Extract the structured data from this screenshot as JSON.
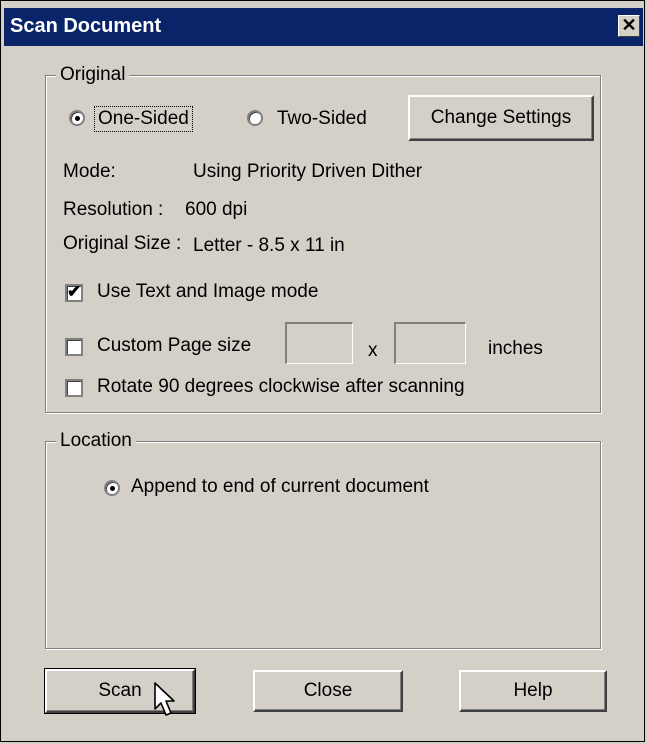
{
  "window": {
    "title": "Scan Document",
    "close_glyph": "✕"
  },
  "original": {
    "legend": "Original",
    "one_sided": "One-Sided",
    "two_sided": "Two-Sided",
    "change_settings": "Change Settings",
    "mode_label": "Mode:",
    "mode_value": "Using Priority Driven Dither",
    "resolution_label": "Resolution :",
    "resolution_value": "600 dpi",
    "size_label": "Original Size :",
    "size_value": "Letter - 8.5 x 11 in",
    "text_image_mode": "Use Text and Image mode",
    "text_image_checked": true,
    "custom_page_size": "Custom Page size",
    "custom_checked": false,
    "custom_width": "",
    "custom_height": "",
    "times": "x",
    "units": "inches",
    "rotate": "Rotate 90 degrees clockwise after scanning",
    "rotate_checked": false
  },
  "location": {
    "legend": "Location",
    "append": "Append to end of current document"
  },
  "buttons": {
    "scan": "Scan",
    "close": "Close",
    "help": "Help"
  }
}
